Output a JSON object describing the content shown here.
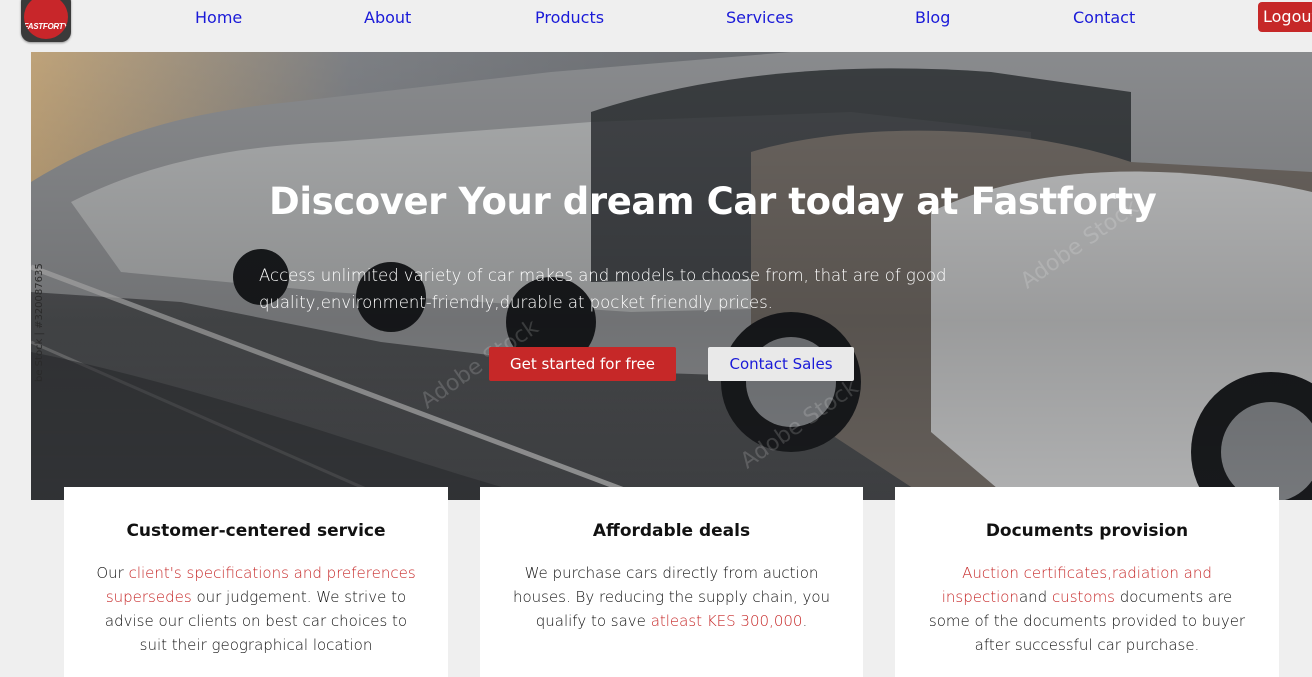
{
  "nav": {
    "logo_text": "FASTFORTY",
    "links": [
      "Home",
      "About",
      "Products",
      "Services",
      "Blog",
      "Contact"
    ],
    "logout_label": "Logout"
  },
  "hero": {
    "title": "Discover Your dream Car today at Fastforty",
    "subtitle": "Access unlimited variety of car makes and models to choose from, that are of good quality,environment-friendly,durable at pocket friendly prices.",
    "primary_button": "Get started for free",
    "secondary_button": "Contact Sales",
    "watermark": "be Stock | #320087635",
    "faint_watermark": "Adobe Stock"
  },
  "cards": [
    {
      "title": "Customer-centered service",
      "text_parts": [
        {
          "text": "Our ",
          "highlight": false
        },
        {
          "text": "client's specifications and preferences supersedes",
          "highlight": true
        },
        {
          "text": " our judgement. We strive to advise our clients on best car choices to suit their geographical location",
          "highlight": false
        }
      ]
    },
    {
      "title": "Affordable deals",
      "text_parts": [
        {
          "text": "We purchase cars directly from auction houses. By reducing the supply chain, you qualify to save ",
          "highlight": false
        },
        {
          "text": "atleast KES 300,000",
          "highlight": true
        },
        {
          "text": ".",
          "highlight": false
        }
      ]
    },
    {
      "title": "Documents provision",
      "text_parts": [
        {
          "text": "Auction certificates,radiation and inspection",
          "highlight": true
        },
        {
          "text": "and ",
          "highlight": false
        },
        {
          "text": "customs",
          "highlight": true
        },
        {
          "text": " documents are some of the documents provided to buyer after successful car purchase.",
          "highlight": false
        }
      ]
    }
  ],
  "colors": {
    "accent_red": "#c62828",
    "link_blue": "#1a1ad8",
    "page_bg": "#efefef"
  },
  "icons": {
    "logo": "fastforty-logo-icon"
  }
}
